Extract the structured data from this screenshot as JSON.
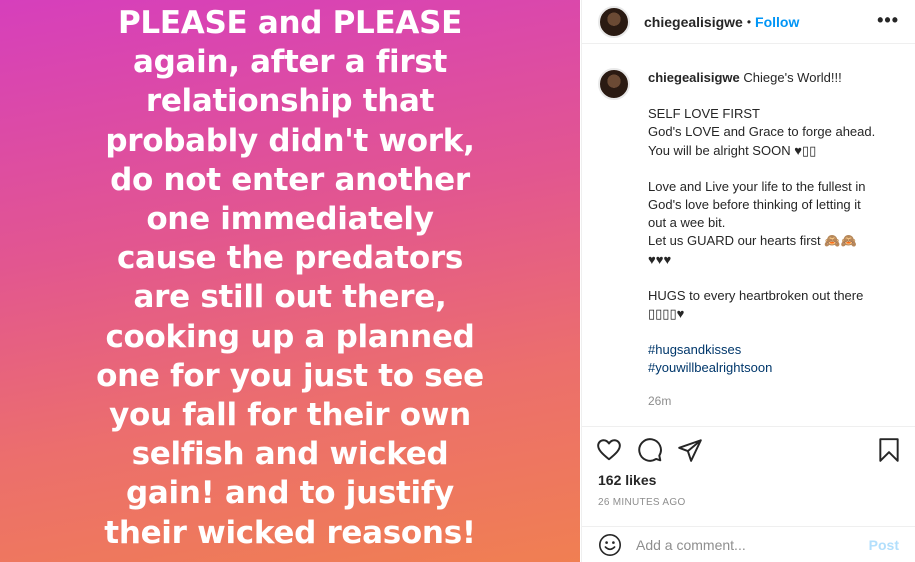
{
  "post_image": {
    "text": "PLEASE and PLEASE\nagain, after a first\nrelationship that\nprobably didn't work,\ndo not enter another\none immediately\ncause the predators\nare still out there,\ncooking up a planned\none for you just to see\nyou fall for their own\nselfish and wicked\ngain! and to justify\ntheir wicked reasons!",
    "gradient_colors": [
      "#d63fbc",
      "#e25690",
      "#ec6f6c",
      "#f07f52"
    ]
  },
  "header": {
    "username": "chiegealisigwe",
    "separator": "•",
    "follow_label": "Follow",
    "more_icon": "more-horizontal-icon"
  },
  "caption": {
    "username": "chiegealisigwe",
    "intro": "Chiege's World!!!",
    "lines": [
      "SELF LOVE FIRST",
      "God's LOVE and Grace to forge ahead.",
      "You will be alright SOON ♥▯▯",
      "",
      "Love and Live your life to the fullest in",
      "God's love before thinking of letting it",
      "out a wee bit.",
      "Let us GUARD our hearts first 🙈🙈",
      "♥♥♥",
      "",
      "HUGS to every heartbroken out there",
      "▯▯▯▯♥"
    ],
    "hashtags": [
      "#hugsandkisses",
      "#youwillbealrightsoon"
    ],
    "age": "26m"
  },
  "actions": {
    "like_icon": "heart-icon",
    "comment_icon": "comment-icon",
    "share_icon": "send-icon",
    "save_icon": "bookmark-icon"
  },
  "likes_label": "162 likes",
  "posted_ago": "26 MINUTES AGO",
  "comment": {
    "emoji_icon": "emoji-icon",
    "placeholder": "Add a comment...",
    "post_label": "Post"
  },
  "colors": {
    "accent": "#0095f6",
    "post_disabled": "#b2dffc",
    "hashtag": "#00376b",
    "muted": "#8e8e8e"
  }
}
